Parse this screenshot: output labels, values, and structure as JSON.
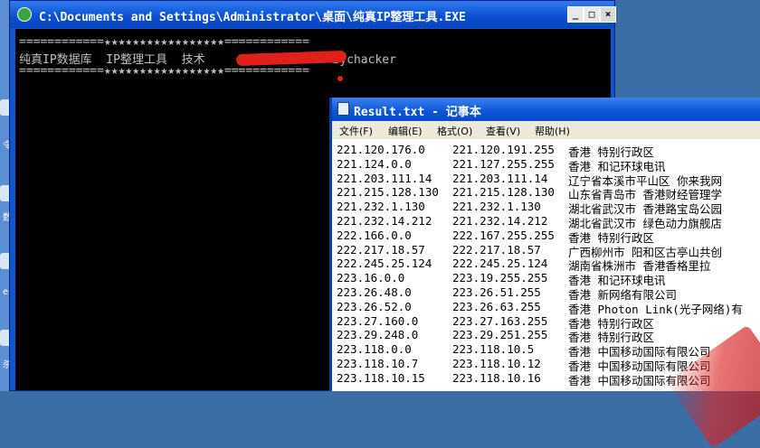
{
  "desktop": {
    "labels": [
      "令",
      "数",
      "er",
      "杀"
    ]
  },
  "console": {
    "title": "C:\\Documents and Settings\\Administrator\\桌面\\纯真IP整理工具.EXE",
    "buttons": {
      "minimize": "_",
      "maximize": "□",
      "close": "×"
    },
    "lines": [
      "============★★★★★★★★★★★★★★★★★============",
      "纯真IP数据库  IP整理工具  技术                  Bychacker",
      "============★★★★★★★★★★★★★★★★★============"
    ]
  },
  "notepad": {
    "title": "Result.txt - 记事本",
    "menu": [
      "文件(F)",
      "编辑(E)",
      "格式(O)",
      "查看(V)",
      "帮助(H)"
    ],
    "rows": [
      [
        "221.120.176.0",
        "221.120.191.255",
        "香港 特别行政区"
      ],
      [
        "221.124.0.0",
        "221.127.255.255",
        "香港 和记环球电讯"
      ],
      [
        "221.203.111.14",
        "221.203.111.14",
        "辽宁省本溪市平山区 你来我网"
      ],
      [
        "221.215.128.130",
        "221.215.128.130",
        "山东省青岛市 香港财经管理学"
      ],
      [
        "221.232.1.130",
        "221.232.1.130",
        "湖北省武汉市 香港路宝岛公园"
      ],
      [
        "221.232.14.212",
        "221.232.14.212",
        "湖北省武汉市 绿色动力旗舰店"
      ],
      [
        "222.166.0.0",
        "222.167.255.255",
        "香港 特别行政区"
      ],
      [
        "222.217.18.57",
        "222.217.18.57",
        "广西柳州市 阳和区古亭山共创"
      ],
      [
        "222.245.25.124",
        "222.245.25.124",
        "湖南省株洲市 香港香格里拉"
      ],
      [
        "223.16.0.0",
        "223.19.255.255",
        "香港 和记环球电讯"
      ],
      [
        "223.26.48.0",
        "223.26.51.255",
        "香港 新网络有限公司"
      ],
      [
        "223.26.52.0",
        "223.26.63.255",
        "香港 Photon Link(光子网络)有"
      ],
      [
        "223.27.160.0",
        "223.27.163.255",
        "香港 特别行政区"
      ],
      [
        "223.29.248.0",
        "223.29.251.255",
        "香港 特别行政区"
      ],
      [
        "223.118.0.0",
        "223.118.10.5",
        "香港 中国移动国际有限公司"
      ],
      [
        "223.118.10.7",
        "223.118.10.12",
        "香港 中国移动国际有限公司"
      ],
      [
        "223.118.10.15",
        "223.118.10.16",
        "香港 中国移动国际有限公司"
      ]
    ]
  }
}
